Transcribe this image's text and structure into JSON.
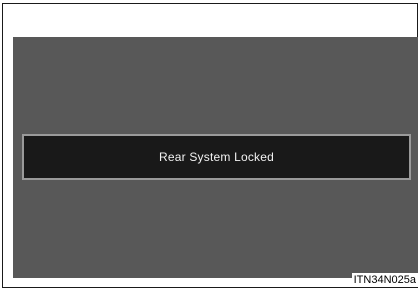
{
  "display": {
    "message": "Rear System Locked"
  },
  "figure": {
    "code": "ITN34N025a"
  }
}
